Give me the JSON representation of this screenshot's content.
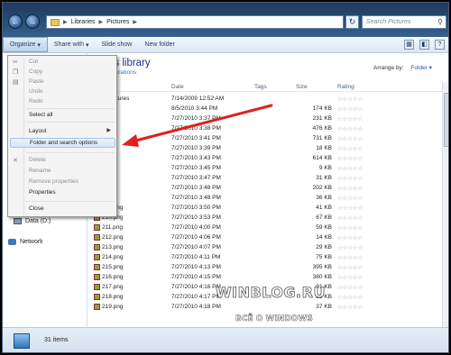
{
  "address": {
    "segments": [
      "Libraries",
      "Pictures"
    ],
    "search_placeholder": "Search Pictures"
  },
  "toolbar": {
    "organize": "Organize",
    "share_with": "Share with",
    "slide_show": "Slide show",
    "new_folder": "New folder"
  },
  "nav": {
    "drive": "Data (D:)",
    "network": "Network"
  },
  "library": {
    "title_visible": "es library",
    "subtitle_visible": "2 locations",
    "arrange_label": "Arrange by:",
    "arrange_value": "Folder"
  },
  "columns": [
    "Date",
    "Tags",
    "Size",
    "Rating"
  ],
  "rows": [
    {
      "name": "le Pictures",
      "date": "7/14/2009 12:52 AM",
      "size": ""
    },
    {
      "name": "ng",
      "date": "8/5/2010 3:44 PM",
      "size": "174 KB"
    },
    {
      "name": "ng",
      "date": "7/27/2010 3:37 PM",
      "size": "231 KB"
    },
    {
      "name": "ng",
      "date": "7/27/2010 3:38 PM",
      "size": "476 KB"
    },
    {
      "name": "ng",
      "date": "7/27/2010 3:41 PM",
      "size": "731 KB"
    },
    {
      "name": "ng",
      "date": "7/27/2010 3:39 PM",
      "size": "18 KB"
    },
    {
      "name": "ng",
      "date": "7/27/2010 3:43 PM",
      "size": "614 KB"
    },
    {
      "name": "ng",
      "date": "7/27/2010 3:45 PM",
      "size": "9 KB"
    },
    {
      "name": "ng",
      "date": "7/27/2010 3:47 PM",
      "size": "31 KB"
    },
    {
      "name": "ng",
      "date": "7/27/2010 3:48 PM",
      "size": "202 KB"
    },
    {
      "name": "ng",
      "date": "7/27/2010 3:48 PM",
      "size": "36 KB"
    },
    {
      "name": "209.png",
      "date": "7/27/2010 3:50 PM",
      "size": "41 KB"
    },
    {
      "name": "210.png",
      "date": "7/27/2010 3:53 PM",
      "size": "67 KB"
    },
    {
      "name": "211.png",
      "date": "7/27/2010 4:00 PM",
      "size": "59 KB"
    },
    {
      "name": "212.png",
      "date": "7/27/2010 4:06 PM",
      "size": "14 KB"
    },
    {
      "name": "213.png",
      "date": "7/27/2010 4:07 PM",
      "size": "29 KB"
    },
    {
      "name": "214.png",
      "date": "7/27/2010 4:11 PM",
      "size": "75 KB"
    },
    {
      "name": "215.png",
      "date": "7/27/2010 4:13 PM",
      "size": "395 KB"
    },
    {
      "name": "216.png",
      "date": "7/27/2010 4:15 PM",
      "size": "380 KB"
    },
    {
      "name": "217.png",
      "date": "7/27/2010 4:16 PM",
      "size": "91 KB"
    },
    {
      "name": "218.png",
      "date": "7/27/2010 4:17 PM",
      "size": "23 KB"
    },
    {
      "name": "219.png",
      "date": "7/27/2010 4:18 PM",
      "size": "37 KB"
    }
  ],
  "rating_glyph": "☆☆☆☆☆",
  "menu": {
    "cut": "Cut",
    "copy": "Copy",
    "paste": "Paste",
    "undo": "Undo",
    "redo": "Redo",
    "select_all": "Select all",
    "layout": "Layout",
    "folder_options": "Folder and search options",
    "delete": "Delete",
    "rename": "Rename",
    "remove_properties": "Remove properties",
    "properties": "Properties",
    "close": "Close"
  },
  "status": {
    "count": "31 items"
  },
  "watermark": {
    "line1": "WINBLOG.RU",
    "line2": "ВСЁ О WINDOWS"
  },
  "colors": {
    "arrow": "#e02020",
    "title": "#1e3287"
  }
}
